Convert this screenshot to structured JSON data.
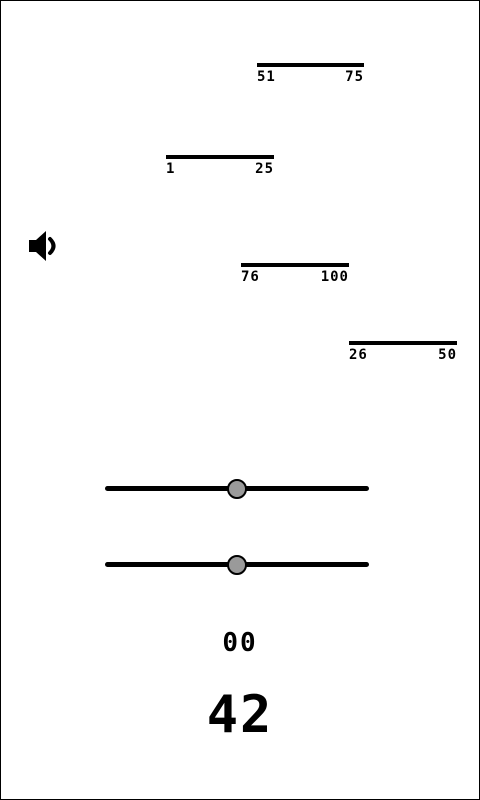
{
  "ranges": [
    {
      "low": "51",
      "high": "75"
    },
    {
      "low": "1",
      "high": "25"
    },
    {
      "low": "76",
      "high": "100"
    },
    {
      "low": "26",
      "high": "50"
    }
  ],
  "icons": {
    "speaker": "speaker-icon"
  },
  "sliders": [
    {
      "name": "slider-1",
      "value_fraction": 0.5
    },
    {
      "name": "slider-2",
      "value_fraction": 0.5
    }
  ],
  "display": {
    "small_value": "00",
    "big_value": "42"
  },
  "colors": {
    "foreground": "#000000",
    "background": "#ffffff",
    "thumb": "#9a9a9a"
  }
}
